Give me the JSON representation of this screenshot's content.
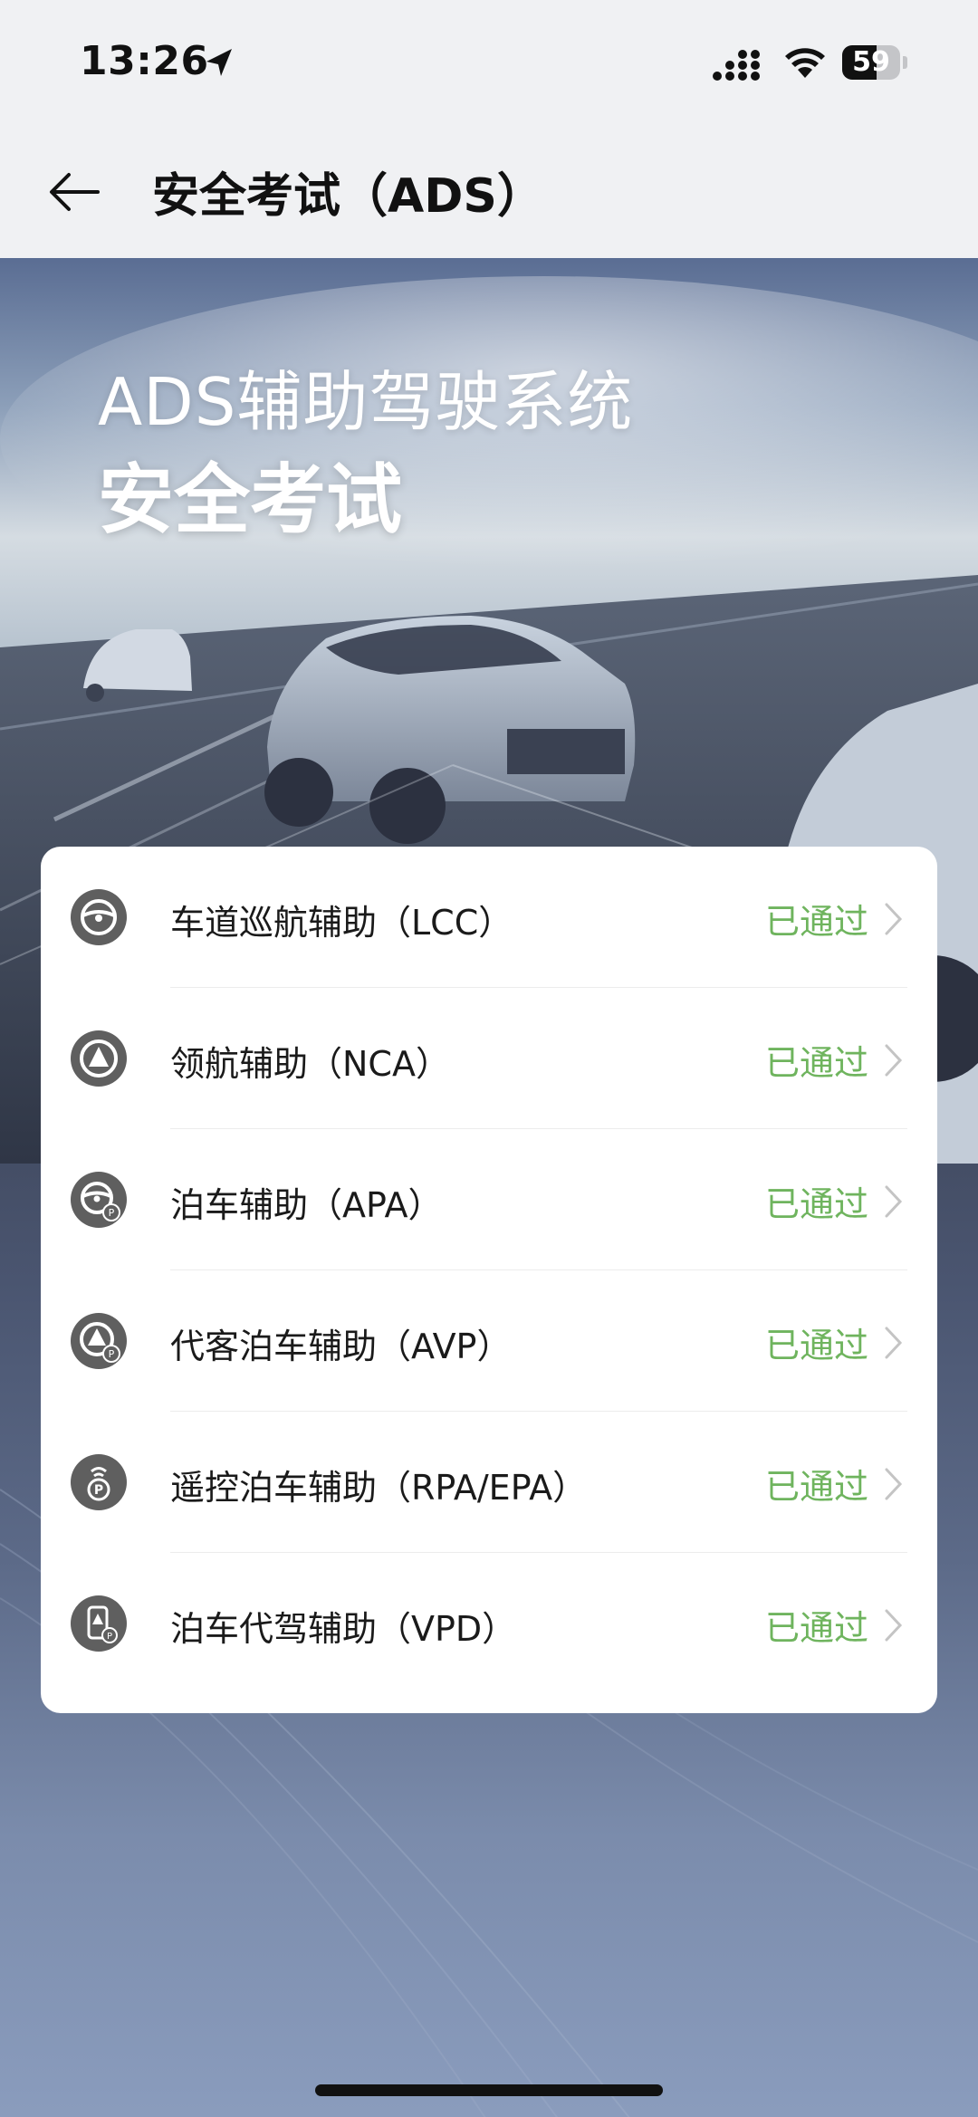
{
  "status_bar": {
    "time": "13:26",
    "battery_level": "59",
    "battery_fraction": 0.59,
    "icons": [
      "location-arrow-icon",
      "signal-icon",
      "wifi-icon",
      "battery-icon"
    ]
  },
  "nav": {
    "title": "安全考试（ADS）",
    "back_icon": "back-arrow-icon"
  },
  "hero": {
    "line1": "ADS辅助驾驶系统",
    "line2": "安全考试"
  },
  "exam_list": {
    "items": [
      {
        "label": "车道巡航辅助（LCC）",
        "status": "已通过",
        "icon": "steering-wheel-icon"
      },
      {
        "label": "领航辅助（NCA）",
        "status": "已通过",
        "icon": "navigation-triangle-icon"
      },
      {
        "label": "泊车辅助（APA）",
        "status": "已通过",
        "icon": "steering-wheel-parking-icon"
      },
      {
        "label": "代客泊车辅助（AVP）",
        "status": "已通过",
        "icon": "navigation-parking-icon"
      },
      {
        "label": "遥控泊车辅助（RPA/EPA）",
        "status": "已通过",
        "icon": "remote-parking-icon"
      },
      {
        "label": "泊车代驾辅助（VPD）",
        "status": "已通过",
        "icon": "phone-parking-icon"
      }
    ]
  },
  "colors": {
    "status_passed": "#6fb45e",
    "icon_bg": "#5f5f5f",
    "card_bg": "#ffffff"
  }
}
